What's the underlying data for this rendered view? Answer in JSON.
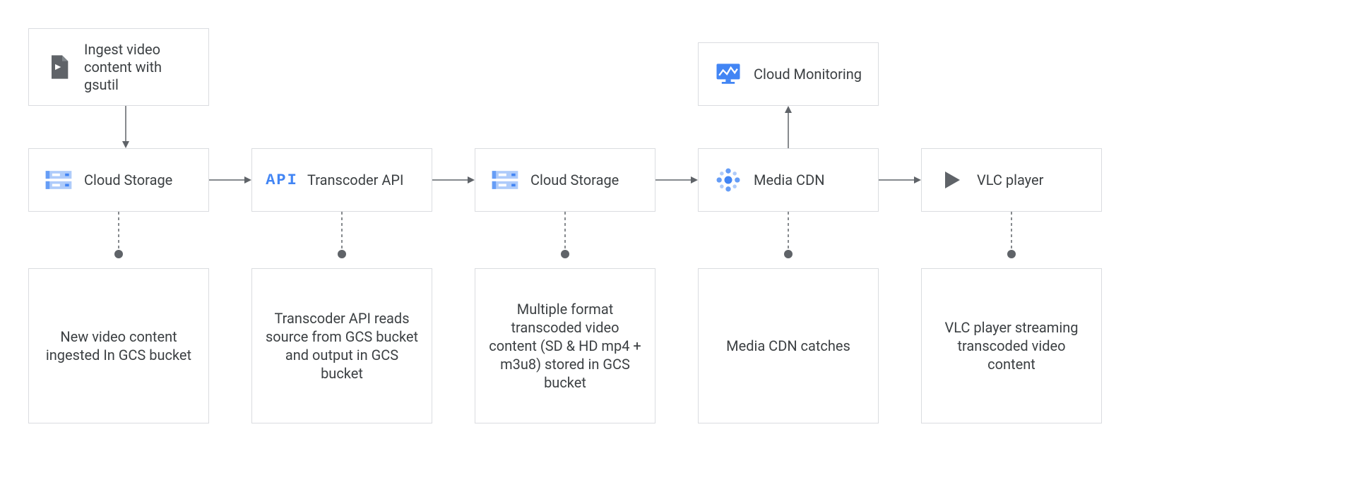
{
  "nodes": {
    "ingest": {
      "label": "Ingest video content with gsutil"
    },
    "storage1": {
      "label": "Cloud Storage"
    },
    "transcoder": {
      "label": "Transcoder API"
    },
    "storage2": {
      "label": "Cloud Storage"
    },
    "mediaCdn": {
      "label": "Media CDN"
    },
    "monitoring": {
      "label": "Cloud Monitoring"
    },
    "vlc": {
      "label": "VLC player"
    }
  },
  "descriptions": {
    "storage1": "New video content ingested In GCS bucket",
    "transcoder": "Transcoder API reads source from GCS bucket and output in GCS bucket",
    "storage2": "Multiple format transcoded video content (SD & HD mp4 + m3u8) stored in GCS bucket",
    "mediaCdn": "Media CDN catches",
    "vlc": "VLC player streaming transcoded video content"
  },
  "icons": {
    "video_file": "video-file-icon",
    "cloud_storage": "cloud-storage-icon",
    "api": "api-icon",
    "media_cdn": "media-cdn-icon",
    "monitoring": "monitoring-icon",
    "play": "play-icon"
  }
}
